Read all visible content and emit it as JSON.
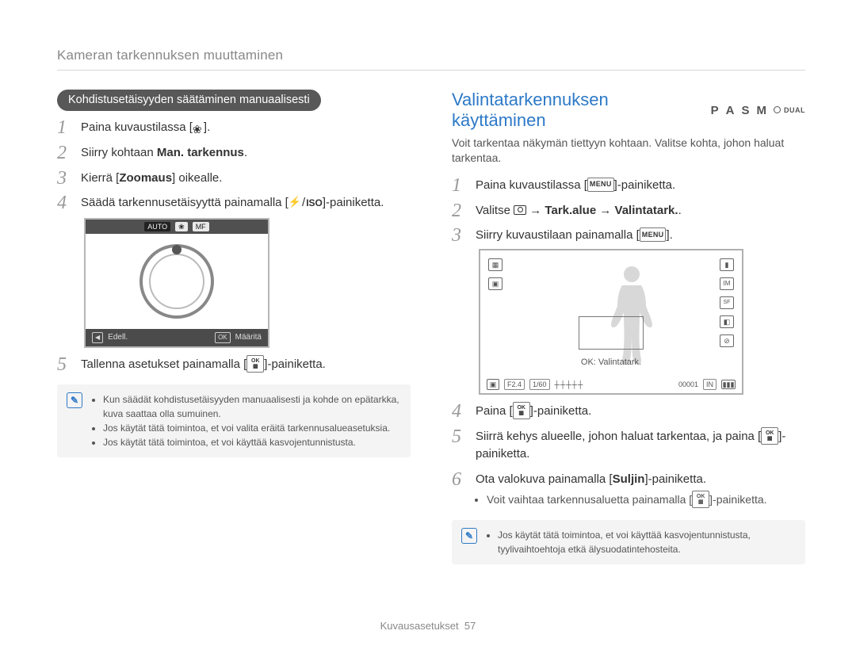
{
  "breadcrumb": "Kameran tarkennuksen muuttaminen",
  "left": {
    "pill": "Kohdistusetäisyyden säätäminen manuaalisesti",
    "steps": {
      "1": "Paina kuvaustilassa [",
      "1_end": "].",
      "2_a": "Siirry kohtaan ",
      "2_b": "Man. tarkennus",
      "2_c": ".",
      "3_a": "Kierrä [",
      "3_b": "Zoomaus",
      "3_c": "] oikealle.",
      "4_a": "Säädä tarkennusetäisyyttä painamalla [",
      "4_iso": "ISO",
      "4_b": "]-painiketta.",
      "5_a": "Tallenna asetukset painamalla [",
      "5_b": "]-painiketta."
    },
    "lcd": {
      "chip_auto": "AUTO",
      "chip_mf": "MF",
      "edell": "Edell.",
      "ok": "OK",
      "maarita": "Määritä"
    },
    "notes": [
      "Kun säädät kohdistusetäisyyden manuaalisesti ja kohde on epätarkka, kuva saattaa olla sumuinen.",
      "Jos käytät tätä toimintoa, et voi valita eräitä tarkennusalueasetuksia.",
      "Jos käytät tätä toimintoa, et voi käyttää kasvojentunnistusta."
    ]
  },
  "right": {
    "title": "Valintatarkennuksen käyttäminen",
    "modes": {
      "p": "P",
      "a": "A",
      "s": "S",
      "m": "M",
      "dual": "DUAL"
    },
    "intro": "Voit tarkentaa näkymän tiettyyn kohtaan. Valitse kohta, johon haluat tarkentaa.",
    "steps": {
      "1_a": "Paina kuvaustilassa [",
      "1_menu": "MENU",
      "1_b": "]-painiketta.",
      "2_a": "Valitse ",
      "2_b": " → ",
      "2_c": "Tark.alue",
      "2_d": " → ",
      "2_e": "Valintatark.",
      "2_f": ".",
      "3_a": "Siirry kuvaustilaan painamalla [",
      "3_menu": "MENU",
      "3_b": "].",
      "4_a": "Paina [",
      "4_b": "]-painiketta.",
      "5_a": "Siirrä kehys alueelle, johon haluat tarkentaa, ja paina [",
      "5_b": "]-painiketta.",
      "6_a": "Ota valokuva painamalla [",
      "6_b": "Suljin",
      "6_c": "]-painiketta.",
      "6_sub": "Voit vaihtaa tarkennusaluetta painamalla [",
      "6_sub_end": "]-painiketta."
    },
    "preview": {
      "okline": "OK: Valintatark.",
      "f": "F2.4",
      "sh": "1/60",
      "count": "00001",
      "mem": "IN"
    },
    "notes": [
      "Jos käytät tätä toimintoa, et voi käyttää kasvojentunnistusta, tyylivaihtoehtoja etkä älysuodatintehosteita."
    ]
  },
  "footer": {
    "section": "Kuvausasetukset",
    "page": "57"
  }
}
